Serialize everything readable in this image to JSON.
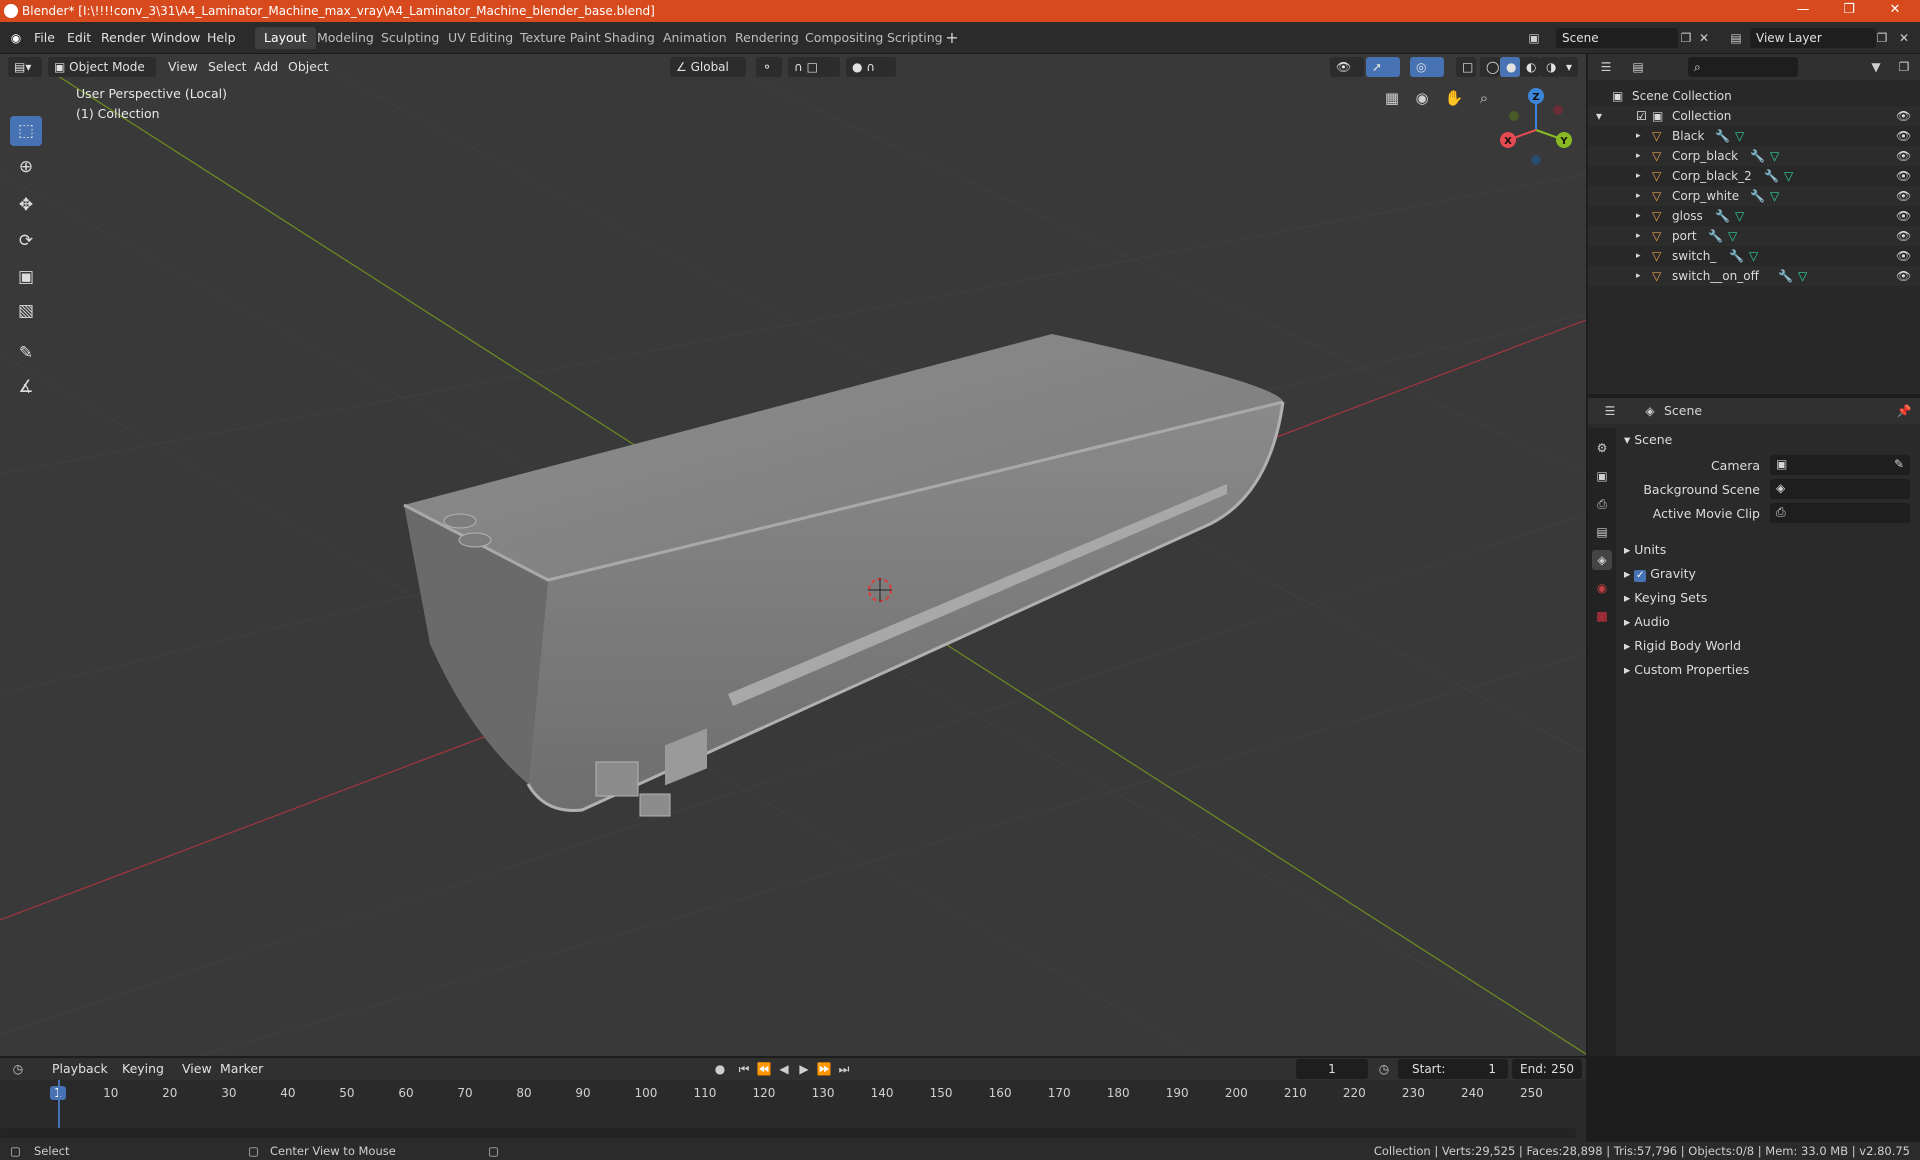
{
  "window": {
    "title": "Blender* [I:\\!!!!conv_3\\31\\A4_Laminator_Machine_max_vray\\A4_Laminator_Machine_blender_base.blend]"
  },
  "menu": [
    "File",
    "Edit",
    "Render",
    "Window",
    "Help"
  ],
  "workspaces": [
    "Layout",
    "Modeling",
    "Sculpting",
    "UV Editing",
    "Texture Paint",
    "Shading",
    "Animation",
    "Rendering",
    "Compositing",
    "Scripting"
  ],
  "workspace_active": "Layout",
  "scene": {
    "name": "Scene",
    "view_layer": "View Layer"
  },
  "viewport": {
    "mode": "Object Mode",
    "menus": [
      "View",
      "Select",
      "Add",
      "Object"
    ],
    "orientation": "Global",
    "info_line1": "User Perspective (Local)",
    "info_line2": "(1) Collection",
    "gizmo": {
      "x": "X",
      "y": "Y",
      "z": "Z"
    }
  },
  "outliner": {
    "root": "Scene Collection",
    "collection": "Collection",
    "objects": [
      "Black",
      "Corp_black",
      "Corp_black_2",
      "Corp_white",
      "gloss",
      "port",
      "switch_",
      "switch__on_off"
    ]
  },
  "properties": {
    "header": "Scene",
    "panel_title": "Scene",
    "camera_label": "Camera",
    "background_label": "Background Scene",
    "movieclip_label": "Active Movie Clip",
    "panels": [
      "Units",
      "Gravity",
      "Keying Sets",
      "Audio",
      "Rigid Body World",
      "Custom Properties"
    ]
  },
  "timeline": {
    "menus": [
      "Playback",
      "Keying",
      "View",
      "Marker"
    ],
    "current_frame": "1",
    "start_label": "Start:",
    "start": "1",
    "end_label": "End:",
    "end": "250",
    "ticks": [
      "1",
      "10",
      "20",
      "30",
      "40",
      "50",
      "60",
      "70",
      "80",
      "90",
      "100",
      "110",
      "120",
      "130",
      "140",
      "150",
      "160",
      "170",
      "180",
      "190",
      "200",
      "210",
      "220",
      "230",
      "240",
      "250"
    ]
  },
  "status": {
    "select": "Select",
    "center": "Center View to Mouse",
    "stats": "Collection | Verts:29,525 | Faces:28,898 | Tris:57,796 | Objects:0/8 | Mem: 33.0 MB | v2.80.75"
  },
  "colors": {
    "titlebar": "#d74a1d",
    "accent": "#4772b3",
    "axis_x": "#e44b53",
    "axis_y": "#8bb924",
    "axis_z": "#3b86d9",
    "mesh_icon": "#e6a14a"
  }
}
